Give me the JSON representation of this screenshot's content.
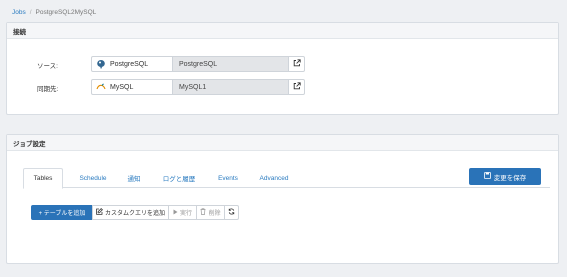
{
  "breadcrumb": {
    "root": "Jobs",
    "current": "PostgreSQL2MySQL"
  },
  "connection": {
    "title": "接続",
    "source": {
      "label": "ソース:",
      "type": "PostgreSQL",
      "name": "PostgreSQL"
    },
    "destination": {
      "label": "同期先:",
      "type": "MySQL",
      "name": "MySQL1"
    }
  },
  "job": {
    "title": "ジョブ設定",
    "tabs": [
      "Tables",
      "Schedule",
      "通知",
      "ログと履歴",
      "Events",
      "Advanced"
    ],
    "save_label": "変更を保存",
    "toolbar": {
      "add_table": "+ テーブルを追加",
      "add_custom_query": "カスタムクエリを追加",
      "run": "実行",
      "delete": "削除"
    }
  },
  "colors": {
    "accent": "#2a73b8",
    "link": "#2a7bc0"
  }
}
